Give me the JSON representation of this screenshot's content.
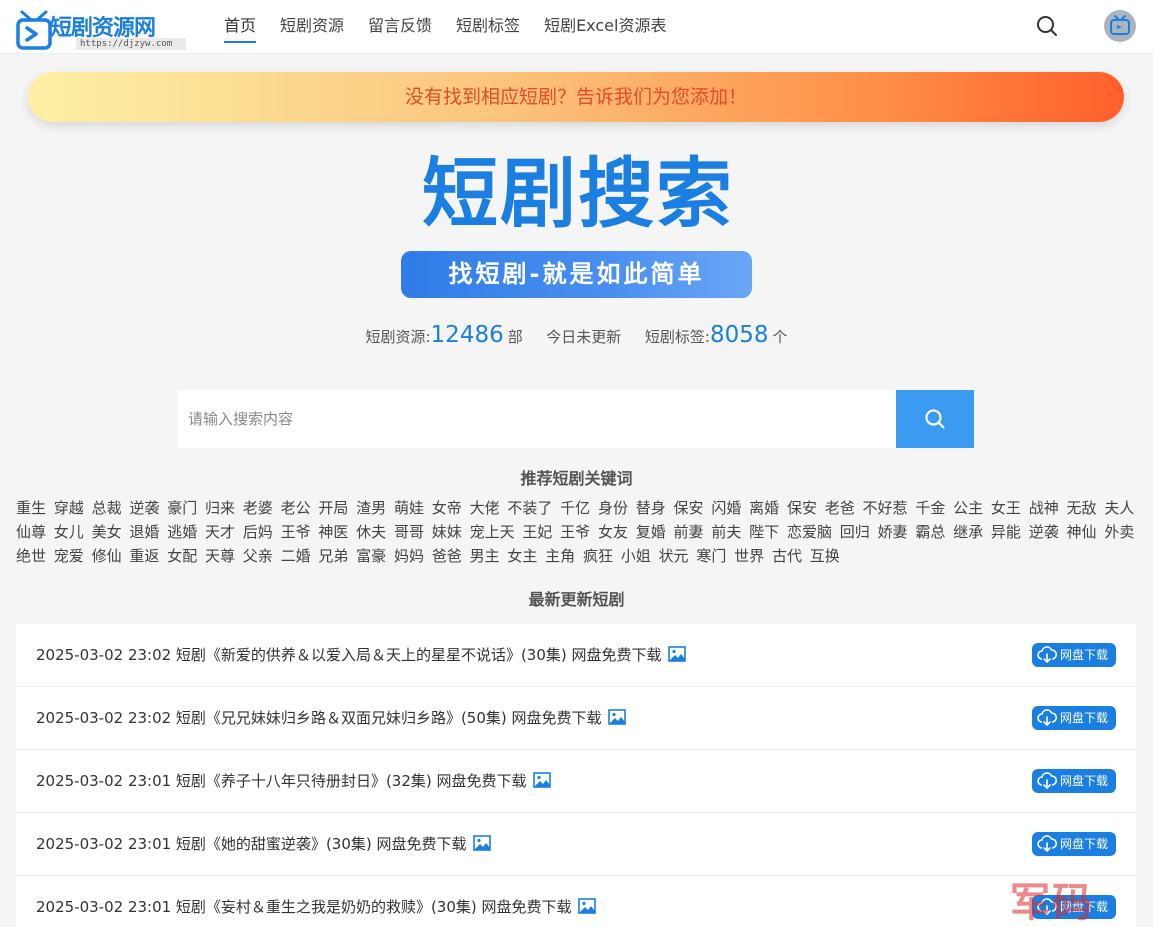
{
  "header": {
    "logo_text": "短剧资源网",
    "logo_url": "https://djzyw.com",
    "nav": [
      "首页",
      "短剧资源",
      "留言反馈",
      "短剧标签",
      "短剧Excel资源表"
    ]
  },
  "banner": {
    "text": "没有找到相应短剧？告诉我们为您添加！"
  },
  "hero": {
    "title": "短剧搜索",
    "subtitle": "找短剧-就是如此简单"
  },
  "stats": {
    "resources_label": "短剧资源:",
    "resources_count": "12486",
    "resources_unit": "部",
    "today": "今日未更新",
    "tags_label": "短剧标签:",
    "tags_count": "8058",
    "tags_unit": "个"
  },
  "search": {
    "placeholder": "请输入搜索内容"
  },
  "keywords_title": "推荐短剧关键词",
  "keywords": [
    "重生",
    "穿越",
    "总裁",
    "逆袭",
    "豪门",
    "归来",
    "老婆",
    "老公",
    "开局",
    "渣男",
    "萌娃",
    "女帝",
    "大佬",
    "不装了",
    "千亿",
    "身份",
    "替身",
    "保安",
    "闪婚",
    "离婚",
    "保安",
    "老爸",
    "不好惹",
    "千金",
    "公主",
    "女王",
    "战神",
    "无敌",
    "夫人",
    "仙尊",
    "女儿",
    "美女",
    "退婚",
    "逃婚",
    "天才",
    "后妈",
    "王爷",
    "神医",
    "休夫",
    "哥哥",
    "妹妹",
    "宠上天",
    "王妃",
    "王爷",
    "女友",
    "复婚",
    "前妻",
    "前夫",
    "陛下",
    "恋爱脑",
    "回归",
    "娇妻",
    "霸总",
    "继承",
    "异能",
    "逆袭",
    "神仙",
    "外卖",
    "绝世",
    "宠爱",
    "修仙",
    "重返",
    "女配",
    "天尊",
    "父亲",
    "二婚",
    "兄弟",
    "富豪",
    "妈妈",
    "爸爸",
    "男主",
    "女主",
    "主角",
    "疯狂",
    "小姐",
    "状元",
    "寒门",
    "世界",
    "古代",
    "互换"
  ],
  "latest_title": "最新更新短剧",
  "latest": [
    {
      "text": "2025-03-02 23:02 短剧《新爱的供养＆以爱入局＆天上的星星不说话》(30集) 网盘免费下载",
      "button": "网盘下载"
    },
    {
      "text": "2025-03-02 23:02 短剧《兄兄妹妹归乡路＆双面兄妹归乡路》(50集) 网盘免费下载",
      "button": "网盘下载"
    },
    {
      "text": "2025-03-02 23:01 短剧《养子十八年只待册封日》(32集) 网盘免费下载",
      "button": "网盘下载"
    },
    {
      "text": "2025-03-02 23:01 短剧《她的甜蜜逆袭》(30集) 网盘免费下载",
      "button": "网盘下载"
    },
    {
      "text": "2025-03-02 23:01 短剧《妄村＆重生之我是奶奶的救赎》(30集) 网盘免费下载",
      "button": "网盘下载"
    }
  ],
  "watermark": "军码",
  "colors": {
    "accent": "#1a7fe0",
    "banner_text": "#e34b2a",
    "search_button": "#3a9bf0"
  }
}
